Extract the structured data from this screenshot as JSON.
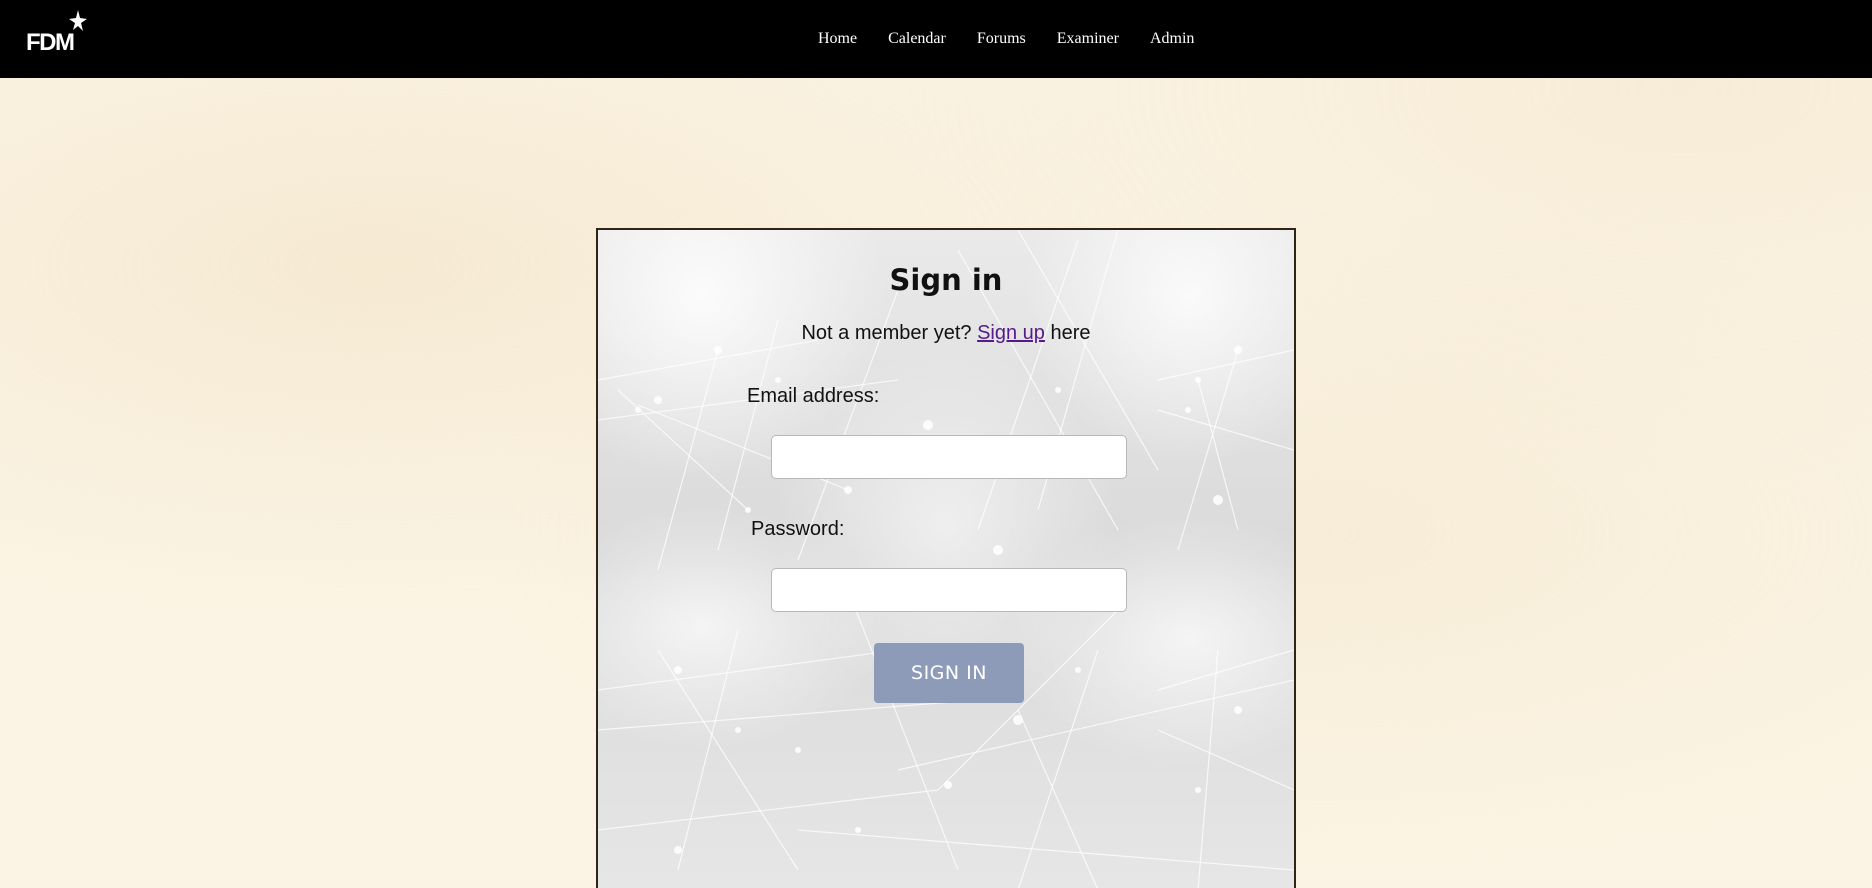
{
  "header": {
    "logo_text": "FDM",
    "nav": [
      {
        "label": "Home"
      },
      {
        "label": "Calendar"
      },
      {
        "label": "Forums"
      },
      {
        "label": "Examiner"
      },
      {
        "label": "Admin"
      }
    ]
  },
  "signin": {
    "title": "Sign in",
    "prompt_prefix": "Not a member yet?",
    "signup_link": "Sign up",
    "prompt_suffix": "here",
    "email_label": "Email address:",
    "email_value": "",
    "password_label": "Password:",
    "password_value": "",
    "submit_label": "SIGN IN"
  },
  "colors": {
    "navbar": "#000000",
    "page_background": "#fbf4e4",
    "button": "#8d9bb9",
    "link": "#551a8b"
  },
  "icons": {
    "logo": "fdm-star-logo"
  }
}
